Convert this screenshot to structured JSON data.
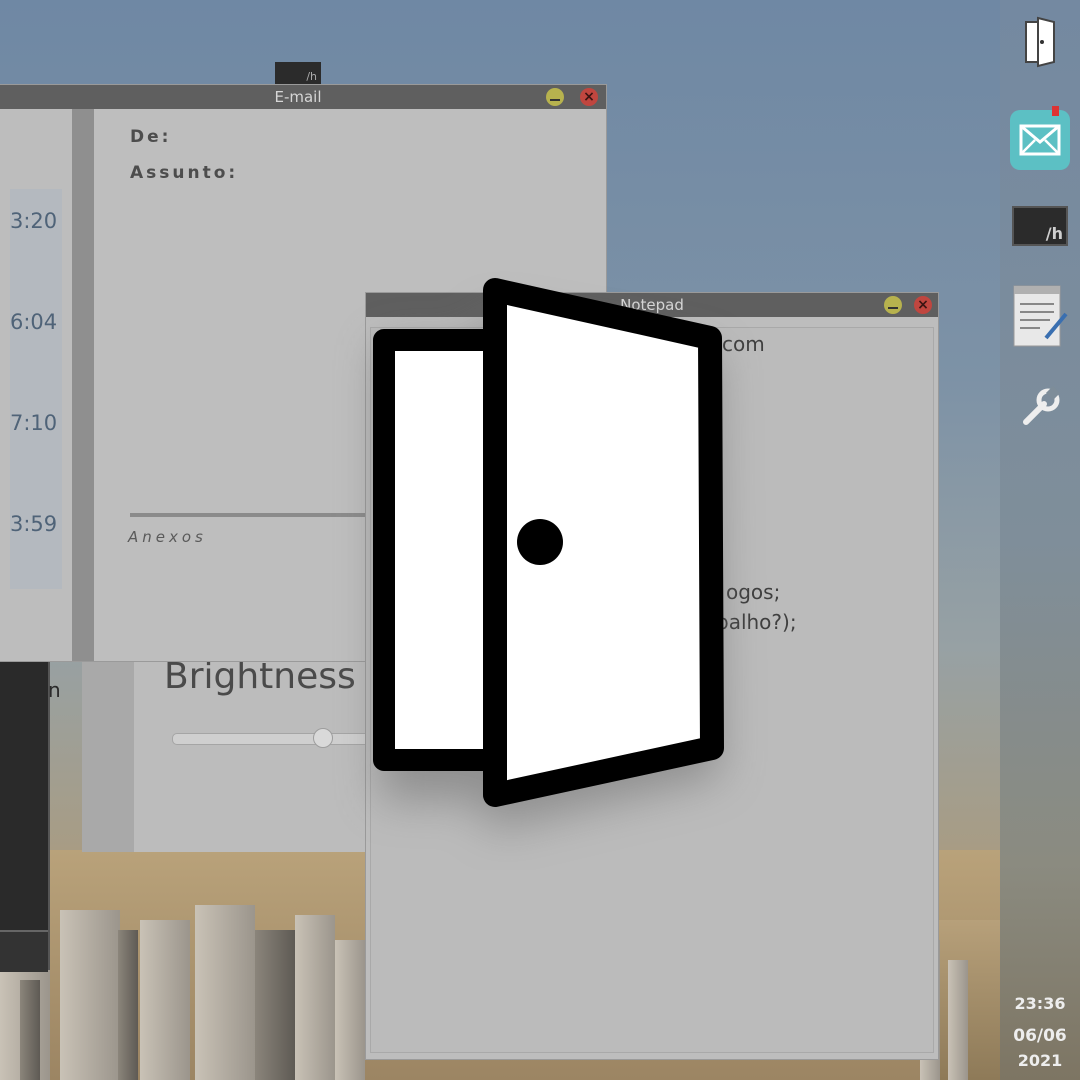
{
  "email": {
    "title": "E-mail",
    "times": [
      "3:20",
      "6:04",
      "7:10",
      "3:59"
    ],
    "from_label": "De:",
    "subject_label": "Assunto:",
    "attachments_label": "Anexos"
  },
  "notepad": {
    "title": "Notepad",
    "lines": [
      "com",
      "ogos;",
      "balho?);"
    ]
  },
  "settings": {
    "brightness_label": "Brightness",
    "brightness_value": 0.75
  },
  "terminal": {
    "partial_text": "n",
    "mini_label": "/h"
  },
  "taskbar": {
    "items": [
      {
        "name": "door-icon"
      },
      {
        "name": "mail-icon"
      },
      {
        "name": "terminal-icon",
        "label": "/h"
      },
      {
        "name": "notepad-icon"
      },
      {
        "name": "wrench-icon"
      }
    ],
    "time": "23:36",
    "date_day": "06/06",
    "date_year": "2021"
  },
  "colors": {
    "accent_mail": "#5cc0c4",
    "titlebar": "#5f5f5f",
    "close_button": "#c0463f",
    "minimize_button": "#b7b24e"
  }
}
